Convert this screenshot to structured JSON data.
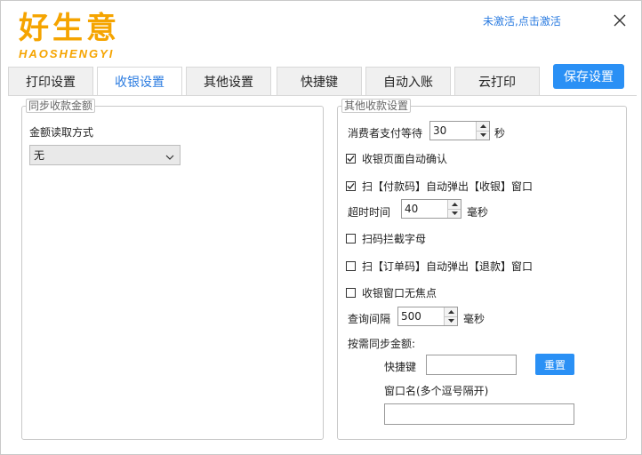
{
  "header": {
    "logo_cn": "好生意",
    "logo_en": "HAOSHENGYI",
    "activate_link": "未激活,点击激活",
    "brand_color": "#f5a400",
    "accent_color": "#2a90f5"
  },
  "tabs": [
    {
      "label": "打印设置",
      "active": false
    },
    {
      "label": "收银设置",
      "active": true
    },
    {
      "label": "其他设置",
      "active": false
    },
    {
      "label": "快捷键",
      "active": false
    },
    {
      "label": "自动入账",
      "active": false
    },
    {
      "label": "云打印",
      "active": false
    }
  ],
  "toolbar": {
    "save_label": "保存设置"
  },
  "sync_group": {
    "title": "同步收款金额",
    "amount_mode_label": "金额读取方式",
    "amount_mode_value": "无"
  },
  "other_group": {
    "title": "其他收款设置",
    "wait_label": "消费者支付等待",
    "wait_value": "30",
    "wait_unit": "秒",
    "auto_confirm": {
      "label": "收银页面自动确认",
      "checked": true
    },
    "scan_pay_popup": {
      "label": "扫【付款码】自动弹出【收银】窗口",
      "checked": true
    },
    "timeout_label": "超时时间",
    "timeout_value": "40",
    "timeout_unit": "毫秒",
    "intercept_letters": {
      "label": "扫码拦截字母",
      "checked": false
    },
    "scan_order_popup": {
      "label": "扫【订单码】自动弹出【退款】窗口",
      "checked": false
    },
    "no_focus": {
      "label": "收银窗口无焦点",
      "checked": false
    },
    "query_label": "查询间隔",
    "query_value": "500",
    "query_unit": "毫秒",
    "sync_amount_label": "按需同步金额:",
    "hotkey_label": "快捷键",
    "hotkey_value": "",
    "reset_label": "重置",
    "window_name_label": "窗口名(多个逗号隔开)",
    "window_name_value": ""
  }
}
